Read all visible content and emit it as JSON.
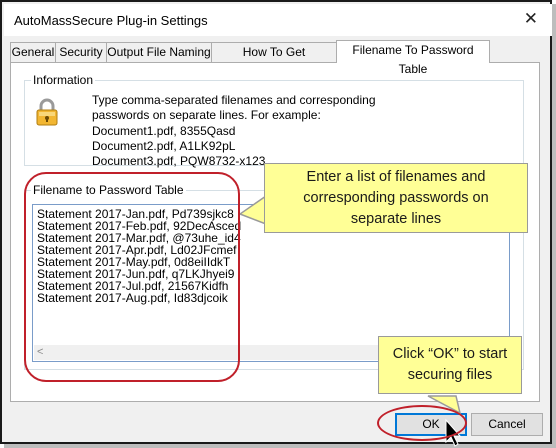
{
  "window": {
    "title": "AutoMassSecure Plug-in Settings",
    "close_glyph": "✕"
  },
  "tabs": [
    {
      "label": "General"
    },
    {
      "label": "Security"
    },
    {
      "label": "Output File Naming"
    },
    {
      "label": "How To Get Passwords"
    },
    {
      "label": "Filename To Password Table",
      "active": true
    }
  ],
  "information": {
    "label": "Information",
    "icon": "lock-icon",
    "lines": [
      "Type comma-separated filenames and corresponding",
      "passwords on separate lines. For example:",
      "Document1.pdf, 8355Qasd",
      "Document2.pdf, A1LK92pL",
      "Document3.pdf, PQW8732-x123"
    ]
  },
  "table": {
    "label": "Filename to Password Table",
    "lines": [
      "Statement 2017-Jan.pdf, Pd739sjkc8",
      "Statement 2017-Feb.pdf, 92DecAsced",
      "Statement 2017-Mar.pdf, @73uhe_id4",
      "Statement 2017-Apr.pdf, Ld02JFcmef",
      "Statement 2017-May.pdf, 0d8eiIIdkT",
      "Statement 2017-Jun.pdf, q7LKJhyei9",
      "Statement 2017-Jul.pdf, 21567Kidfh",
      "Statement 2017-Aug.pdf, Id83djcoik"
    ],
    "scroll_arrow": "<"
  },
  "buttons": {
    "ok": "OK",
    "cancel": "Cancel"
  },
  "callouts": {
    "table_note": [
      "Enter a list of filenames and",
      "corresponding passwords on",
      "separate lines"
    ],
    "ok_note": [
      "Click “OK” to start",
      "securing files"
    ]
  },
  "colors": {
    "callout_fill": "#ffff96",
    "highlight_ring": "#c0202a",
    "focus_border": "#0078d7"
  }
}
